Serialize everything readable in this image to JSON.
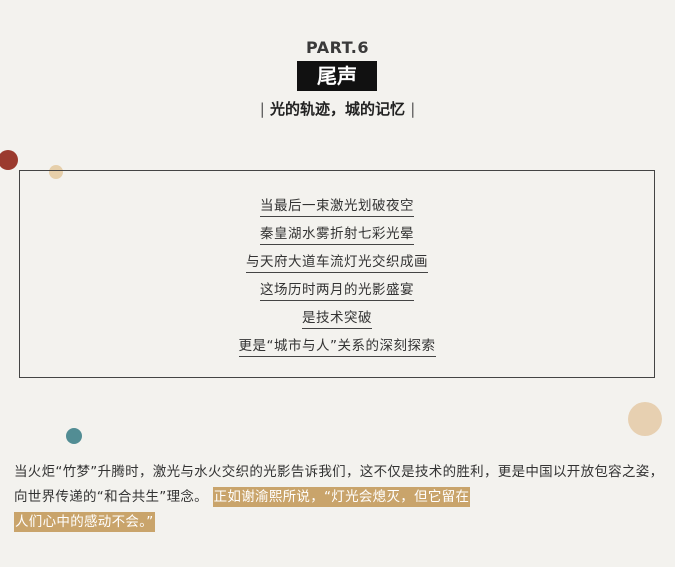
{
  "header": {
    "part": "PART.6",
    "title": "尾声",
    "subtitle": "光的轨迹，城的记忆"
  },
  "poem": {
    "lines": [
      "当最后一束激光划破夜空",
      "秦皇湖水雾折射七彩光晕",
      "与天府大道车流灯光交织成画",
      "这场历时两月的光影盛宴",
      "是技术突破",
      "更是“城市与人”关系的深刻探索"
    ]
  },
  "closing": {
    "text": "当火炬“竹梦”升腾时，激光与水火交织的光影告诉我们，这不仅是技术的胜利，更是中国以开放包容之姿，向世界传递的“和合共生”理念。",
    "highlight_line1": "正如谢渝熙所说，“灯光会熄灭，但它留在",
    "highlight_line2": "人们心中的感动不会。”",
    "highlight_color": "#c9a46b"
  },
  "decor": {
    "dot_colors": [
      "#9b3a2e",
      "#e6cfaa",
      "#528d94",
      "#e7d0b1"
    ]
  }
}
